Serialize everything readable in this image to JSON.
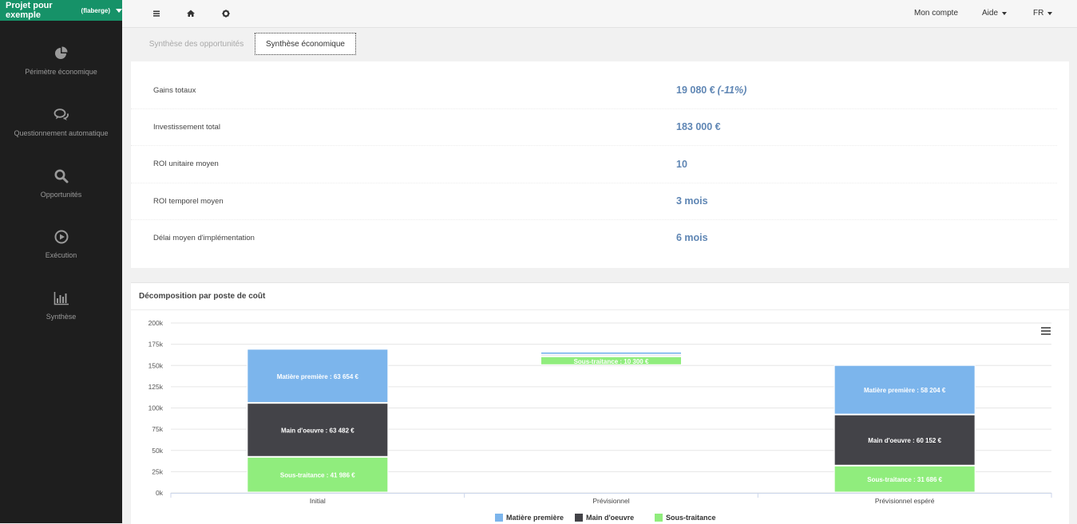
{
  "project": {
    "name": "Projet pour exemple",
    "tag": "(flaberge)"
  },
  "sidebar": {
    "items": [
      {
        "label": "Périmètre économique",
        "icon": "pie-chart-icon"
      },
      {
        "label": "Questionnement automatique",
        "icon": "chat-bubbles-icon"
      },
      {
        "label": "Opportunités",
        "icon": "search-icon"
      },
      {
        "label": "Exécution",
        "icon": "play-circle-icon"
      },
      {
        "label": "Synthèse",
        "icon": "bar-chart-icon"
      }
    ]
  },
  "topbar": {
    "icons": [
      "hamburger-menu-icon",
      "home-icon",
      "gear-icon"
    ],
    "account": "Mon compte",
    "help": "Aide",
    "language": "FR"
  },
  "tabs": [
    {
      "label": "Synthèse des opportunités",
      "active": false
    },
    {
      "label": "Synthèse économique",
      "active": true
    }
  ],
  "kpis": [
    {
      "label": "Gains totaux",
      "value": "19 080 €",
      "extra": "(-11%)"
    },
    {
      "label": "Investissement total",
      "value": "183 000 €",
      "extra": ""
    },
    {
      "label": "ROI unitaire moyen",
      "value": "10",
      "extra": ""
    },
    {
      "label": "ROI temporel moyen",
      "value": "3 mois",
      "extra": ""
    },
    {
      "label": "Délai moyen d'implémentation",
      "value": "6 mois",
      "extra": ""
    }
  ],
  "chart_panel": {
    "title": "Décomposition par poste de coût"
  },
  "chart_data": {
    "type": "bar",
    "stacked": true,
    "categories": [
      "Initial",
      "Prévisionnel",
      "Prévisionnel espéré"
    ],
    "series": [
      {
        "name": "Sous-traitance",
        "color": "#90ed7d",
        "values": [
          41986,
          10300,
          31686
        ],
        "labels": [
          "Sous-traitance : 41 986 €",
          "Sous-traitance : 10 300 €",
          "Sous-traitance : 31 686 €"
        ]
      },
      {
        "name": "Main d'oeuvre",
        "color": "#434348",
        "values": [
          63482,
          2000,
          60152
        ],
        "labels": [
          "Main d'oeuvre : 63 482 €",
          "",
          "Main d'oeuvre : 60 152 €"
        ]
      },
      {
        "name": "Matière première",
        "color": "#7cb5ec",
        "values": [
          63654,
          3500,
          58204
        ],
        "labels": [
          "Matière première : 63 654 €",
          "",
          "Matière première : 58 204 €"
        ]
      }
    ],
    "base_values": [
      0,
      150000,
      0
    ],
    "ylim": [
      0,
      200000
    ],
    "yticks": [
      0,
      25000,
      50000,
      75000,
      100000,
      125000,
      150000,
      175000,
      200000
    ],
    "ytick_labels": [
      "0k",
      "25k",
      "50k",
      "75k",
      "100k",
      "125k",
      "150k",
      "175k",
      "200k"
    ],
    "legend": [
      "Matière première",
      "Main d'oeuvre",
      "Sous-traitance"
    ],
    "legend_position": "bottom-center",
    "grid": true
  }
}
